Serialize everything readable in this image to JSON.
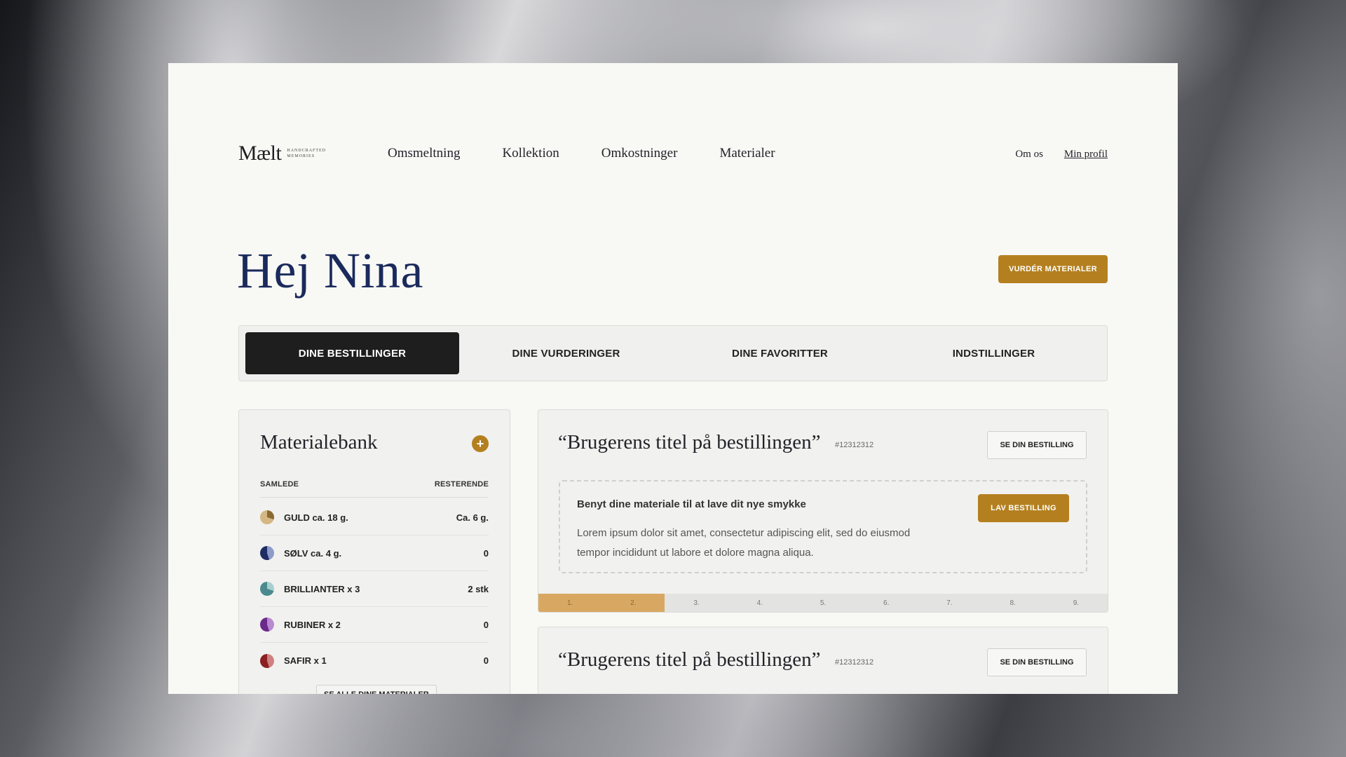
{
  "brand": {
    "word": "Mælt",
    "tagline": "HANDCRAFTED MEMORIES"
  },
  "nav": {
    "items": [
      "Omsmeltning",
      "Kollektion",
      "Omkostninger",
      "Materialer"
    ],
    "about": "Om os",
    "profile": "Min profil"
  },
  "greeting": "Hej Nina",
  "primary_button": "VURDÉR MATERIALER",
  "tabs": [
    "DINE BESTILLINGER",
    "DINE VURDERINGER",
    "DINE FAVORITTER",
    "INDSTILLINGER"
  ],
  "bank": {
    "title": "Materialebank",
    "col_total": "SAMLEDE",
    "col_remaining": "RESTERENDE",
    "rows": [
      {
        "name": "GULD ca. 18 g.",
        "remaining": "Ca. 6 g.",
        "color": "#c9a46a"
      },
      {
        "name": "SØLV ca. 4 g.",
        "remaining": "0",
        "color": "#1d2d63"
      },
      {
        "name": "BRILLIANTER x 3",
        "remaining": "2 stk",
        "color": "#4a8a8e"
      },
      {
        "name": "RUBINER x 2",
        "remaining": "0",
        "color": "#6a2a8a"
      },
      {
        "name": "SAFIR x 1",
        "remaining": "0",
        "color": "#8a2020"
      }
    ],
    "see_all": "SE ALLE DINE MATERIALER"
  },
  "orders": [
    {
      "title": "“Brugerens titel på bestillingen”",
      "id": "#12312312",
      "button": "SE DIN BESTILLING",
      "box_title": "Benyt dine materiale til at lave dit nye smykke",
      "box_text": "Lorem ipsum dolor sit amet, consectetur adipiscing elit, sed do eiusmod tempor incididunt ut labore et dolore magna aliqua.",
      "box_button": "LAV BESTILLING",
      "steps": [
        "1.",
        "2.",
        "3.",
        "4.",
        "5.",
        "6.",
        "7.",
        "8.",
        "9."
      ],
      "completed_steps": 2
    },
    {
      "title": "“Brugerens titel på bestillingen”",
      "id": "#12312312",
      "button": "SE DIN BESTILLING"
    }
  ],
  "colors": {
    "accent": "#b4801f",
    "heading": "#1b2a5c",
    "active_tab": "#1e1e1f"
  }
}
